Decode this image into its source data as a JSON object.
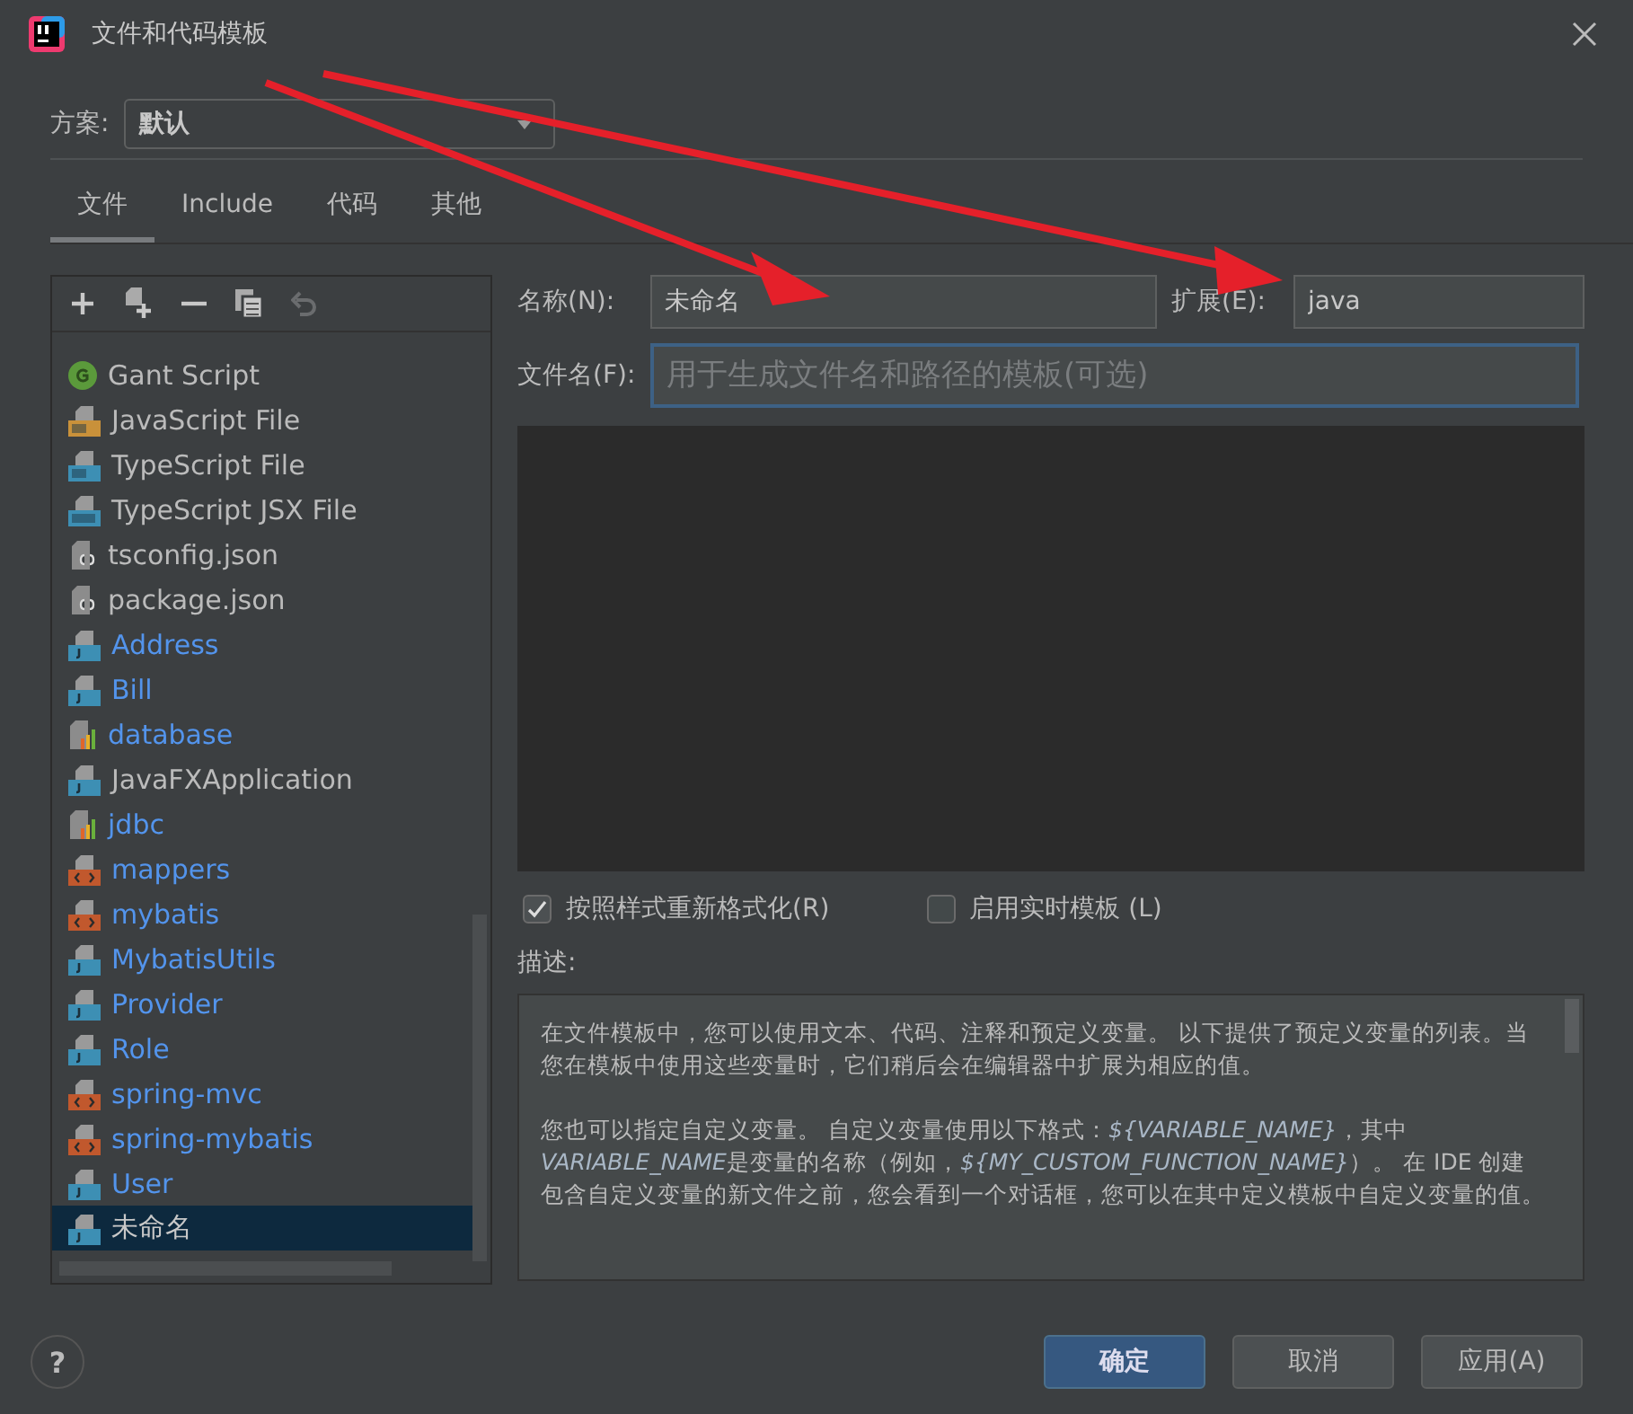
{
  "window": {
    "title": "文件和代码模板"
  },
  "scheme": {
    "label": "方案:",
    "value": "默认"
  },
  "tabs": [
    {
      "label": "文件",
      "selected": true
    },
    {
      "label": "Include",
      "selected": false
    },
    {
      "label": "代码",
      "selected": false
    },
    {
      "label": "其他",
      "selected": false
    }
  ],
  "templates": [
    {
      "name": "Gant Script",
      "kind": "groovy",
      "user_defined": false,
      "selected": false
    },
    {
      "name": "JavaScript File",
      "kind": "js",
      "user_defined": false,
      "selected": false
    },
    {
      "name": "TypeScript File",
      "kind": "ts",
      "user_defined": false,
      "selected": false
    },
    {
      "name": "TypeScript JSX File",
      "kind": "tsx",
      "user_defined": false,
      "selected": false
    },
    {
      "name": "tsconfig.json",
      "kind": "json",
      "user_defined": false,
      "selected": false
    },
    {
      "name": "package.json",
      "kind": "json",
      "user_defined": false,
      "selected": false
    },
    {
      "name": "Address",
      "kind": "java",
      "user_defined": true,
      "selected": false
    },
    {
      "name": "Bill",
      "kind": "java",
      "user_defined": true,
      "selected": false
    },
    {
      "name": "database",
      "kind": "db",
      "user_defined": true,
      "selected": false
    },
    {
      "name": "JavaFXApplication",
      "kind": "java",
      "user_defined": false,
      "selected": false
    },
    {
      "name": "jdbc",
      "kind": "db",
      "user_defined": true,
      "selected": false
    },
    {
      "name": "mappers",
      "kind": "xml",
      "user_defined": true,
      "selected": false
    },
    {
      "name": "mybatis",
      "kind": "xml",
      "user_defined": true,
      "selected": false
    },
    {
      "name": "MybatisUtils",
      "kind": "java",
      "user_defined": true,
      "selected": false
    },
    {
      "name": "Provider",
      "kind": "java",
      "user_defined": true,
      "selected": false
    },
    {
      "name": "Role",
      "kind": "java",
      "user_defined": true,
      "selected": false
    },
    {
      "name": "spring-mvc",
      "kind": "xml",
      "user_defined": true,
      "selected": false
    },
    {
      "name": "spring-mybatis",
      "kind": "xml",
      "user_defined": true,
      "selected": false
    },
    {
      "name": "User",
      "kind": "java",
      "user_defined": true,
      "selected": false
    },
    {
      "name": "未命名",
      "kind": "java",
      "user_defined": false,
      "selected": true
    }
  ],
  "name_field": {
    "label": "名称(N):",
    "value": "未命名"
  },
  "extension_field": {
    "label": "扩展(E):",
    "value": "java"
  },
  "filename_field": {
    "label": "文件名(F):",
    "placeholder": "用于生成文件名和路径的模板(可选)"
  },
  "options": [
    {
      "label": "按照样式重新格式化(R)",
      "checked": true
    },
    {
      "label": "启用实时模板 (L)",
      "checked": false
    }
  ],
  "description": {
    "label": "描述:",
    "paragraphs": [
      [
        {
          "text": "在文件模板中，您可以使用文本、代码、注释和预定义变量。 以下提供了预定义变量的列表。当您在模板中使用这些变量时，它们稍后会在编辑器中扩展为相应的值。",
          "italic": false
        }
      ],
      [
        {
          "text": "您也可以指定自定义变量。 自定义变量使用以下格式：",
          "italic": false
        },
        {
          "text": "${VARIABLE_NAME}",
          "italic": true
        },
        {
          "text": "，其中 ",
          "italic": false
        },
        {
          "text": "VARIABLE_NAME",
          "italic": true
        },
        {
          "text": "是变量的名称（例如，",
          "italic": false
        },
        {
          "text": "${MY_CUSTOM_FUNCTION_NAME}",
          "italic": true
        },
        {
          "text": "）。 在 IDE 创建包含自定义变量的新文件之前，您会看到一个对话框，您可以在其中定义模板中自定义变量的值。",
          "italic": false
        }
      ]
    ]
  },
  "buttons": [
    {
      "label": "确定",
      "kind": "primary"
    },
    {
      "label": "取消",
      "kind": "normal"
    },
    {
      "label": "应用(A)",
      "kind": "normal"
    }
  ],
  "help": {
    "label": "?"
  }
}
